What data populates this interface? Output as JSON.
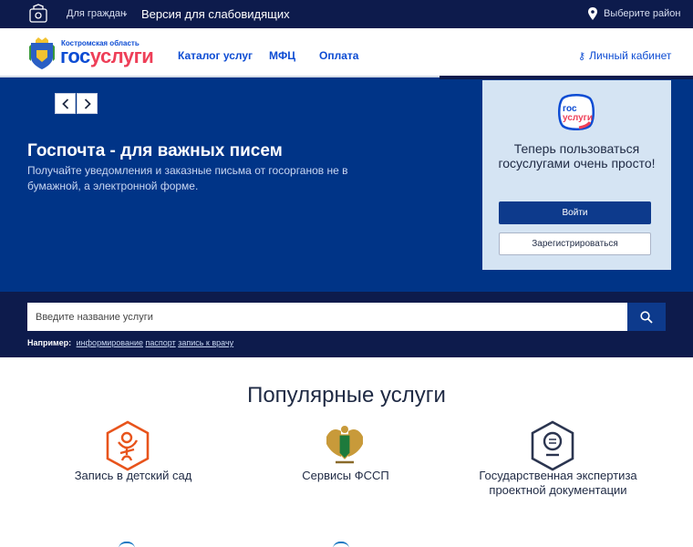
{
  "topbar": {
    "for_citizens": "Для граждан",
    "low_vision": "Версия для слабовидящих",
    "region_select": "Выберите район"
  },
  "header": {
    "logo_region": "Костромская область",
    "logo_gos": "гос",
    "logo_uslugi": "услуги",
    "nav": [
      "Каталог услуг",
      "МФЦ",
      "Оплата"
    ],
    "cabinet": "Личный кабинет"
  },
  "hero": {
    "title": "Госпочта - для важных писем",
    "text": "Получайте уведомления и заказные письма от госорганов не в бумажной, а электронной форме."
  },
  "login_card": {
    "logo_top": "гос",
    "logo_bottom": "услуги",
    "text": "Теперь пользоваться госуслугами очень просто!",
    "login_button": "Войти",
    "register_button": "Зарегистрироваться"
  },
  "search": {
    "placeholder": "Введите название услуги",
    "example_label": "Например:",
    "examples": [
      "информирование",
      "паспорт",
      "запись к врачу"
    ]
  },
  "popular": {
    "title": "Популярные услуги",
    "services": [
      "Запись в детский сад",
      "Сервисы ФССП",
      "Государственная экспертиза проектной документации"
    ]
  },
  "colors": {
    "topbar": "#0d1b4c",
    "hero": "#003487",
    "accent_blue": "#0d4cd3",
    "accent_red": "#ee3f58",
    "kindergarten_orange": "#e8541c",
    "card": "#d5e4f3"
  }
}
